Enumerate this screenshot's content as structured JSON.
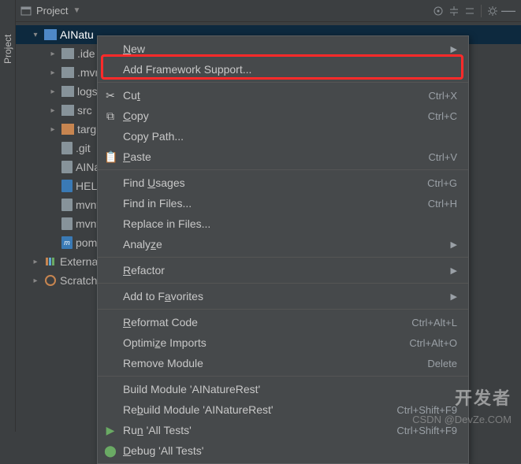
{
  "vtab": {
    "label": "Project"
  },
  "header": {
    "title": "Project"
  },
  "tree": {
    "root": "AINatu",
    "items": [
      {
        "name": ".ide"
      },
      {
        "name": ".mvn"
      },
      {
        "name": "logs"
      },
      {
        "name": "src"
      },
      {
        "name": "targ"
      },
      {
        "name": ".git"
      },
      {
        "name": "AINa"
      },
      {
        "name": "HELI"
      },
      {
        "name": "mvnv"
      },
      {
        "name": "mvnv"
      },
      {
        "name": "pom."
      }
    ],
    "externals": "Externa",
    "scratches": "Scratch"
  },
  "menu": {
    "new": "New",
    "add_framework": "Add Framework Support...",
    "cut": "Cut",
    "cut_sc": "Ctrl+X",
    "copy": "Copy",
    "copy_sc": "Ctrl+C",
    "copy_path": "Copy Path...",
    "paste": "Paste",
    "paste_sc": "Ctrl+V",
    "find_usages": "Find Usages",
    "find_usages_sc": "Ctrl+G",
    "find_in_files": "Find in Files...",
    "find_in_files_sc": "Ctrl+H",
    "replace_in_files": "Replace in Files...",
    "analyze": "Analyze",
    "refactor": "Refactor",
    "add_favorites": "Add to Favorites",
    "reformat": "Reformat Code",
    "reformat_sc": "Ctrl+Alt+L",
    "optimize": "Optimize Imports",
    "optimize_sc": "Ctrl+Alt+O",
    "remove_module": "Remove Module",
    "remove_module_sc": "Delete",
    "build": "Build Module 'AINatureRest'",
    "rebuild": "Rebuild Module 'AINatureRest'",
    "rebuild_sc": "Ctrl+Shift+F9",
    "run": "Run 'All Tests'",
    "run_sc": "Ctrl+Shift+F9",
    "debug": "Debug 'All Tests'"
  },
  "watermark": {
    "main": "开发者",
    "sub": "CSDN @DevZe.COM"
  }
}
